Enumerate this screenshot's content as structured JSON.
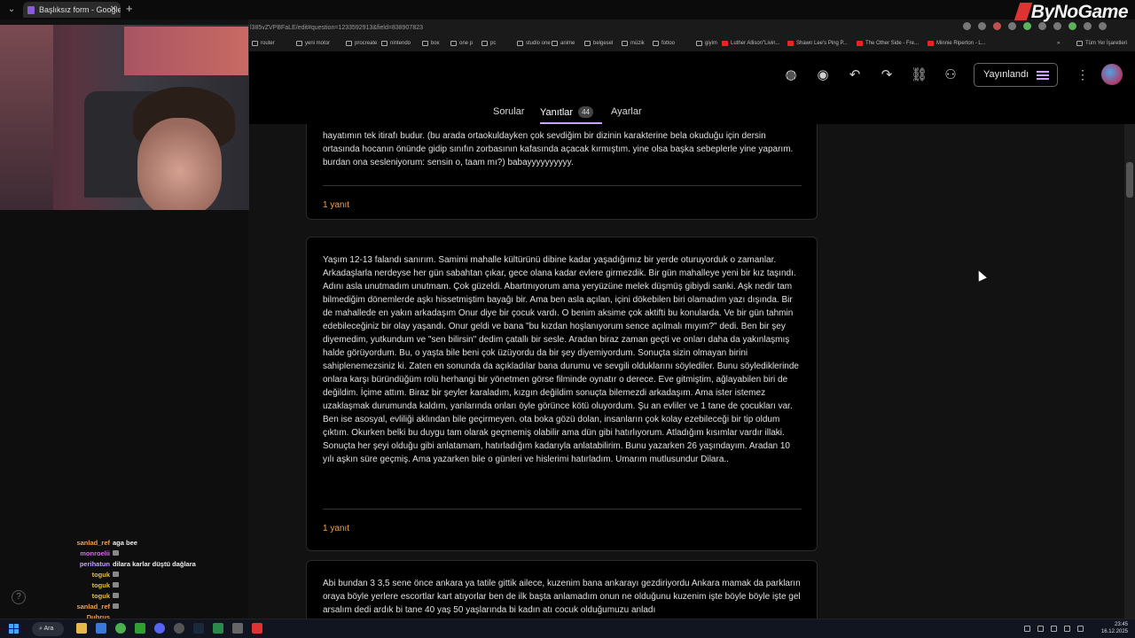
{
  "browser": {
    "tab_title": "Başlıksız form - Google Formlar",
    "tab_close": "✕",
    "new_tab": "+",
    "url": "l385vZVPBFaLE/edit#question=1233592913&field=838907823",
    "bookmarks": [
      {
        "label": "router",
        "kind": "folder"
      },
      {
        "label": "yeni motor",
        "kind": "folder"
      },
      {
        "label": "procreate",
        "kind": "folder"
      },
      {
        "label": "nintendo",
        "kind": "folder"
      },
      {
        "label": "box",
        "kind": "folder"
      },
      {
        "label": "one p",
        "kind": "folder"
      },
      {
        "label": "pc",
        "kind": "folder"
      },
      {
        "label": "studio one",
        "kind": "folder"
      },
      {
        "label": "anime",
        "kind": "folder"
      },
      {
        "label": "belgesel",
        "kind": "folder"
      },
      {
        "label": "müzik",
        "kind": "folder"
      },
      {
        "label": "fottoo",
        "kind": "folder"
      },
      {
        "label": "giyim",
        "kind": "folder"
      },
      {
        "label": "Luther Allison\"Livin...",
        "kind": "youtube"
      },
      {
        "label": "Shawn Lee's Ping P...",
        "kind": "youtube"
      },
      {
        "label": "The Other Side - Fre...",
        "kind": "youtube"
      },
      {
        "label": "Minnie Riperton - L...",
        "kind": "youtube"
      },
      {
        "label": "Tüm Yer İşaretleri",
        "kind": "folder"
      }
    ]
  },
  "logo": "ByNoGame",
  "forms": {
    "publish_label": "Yayınlandı",
    "tabs": {
      "questions": "Sorular",
      "responses": "Yanıtlar",
      "response_count": "44",
      "settings": "Ayarlar"
    }
  },
  "responses": [
    {
      "text": "hayatımın tek itirafı budur. (bu arada ortaokuldayken çok sevdiğim bir dizinin karakterine bela okuduğu için dersin ortasında hocanın önünde gidip sınıfın zorbasının kafasında açacak kırmıştım. yine olsa başka sebeplerle yine yaparım. burdan ona sesleniyorum: sensin o, taam mı?) babayyyyyyyyyy.",
      "reply_label": "1 yanıt"
    },
    {
      "text": "Yaşım 12-13 falandı sanırım. Samimi mahalle kültürünü dibine kadar yaşadığımız bir yerde oturuyorduk o zamanlar. Arkadaşlarla nerdeyse her gün sabahtan çıkar, gece olana kadar evlere girmezdik. Bir gün mahalleye yeni bir kız taşındı. Adını asla unutmadım unutmam. Çok güzeldi. Abartmıyorum ama yeryüzüne melek düşmüş gibiydi sanki. Aşk nedir tam bilmediğim dönemlerde aşkı hissetmiştim bayağı bir. Ama ben asla açılan, içini dökebilen biri olamadım yazı dışında. Bir de mahallede en yakın arkadaşım Onur diye bir çocuk vardı. O benim aksime çok aktifti bu konularda. Ve bir gün tahmin edebileceğiniz bir olay yaşandı. Onur geldi ve bana \"bu kızdan hoşlanıyorum sence açılmalı mıyım?\" dedi. Ben bir şey diyemedim, yutkundum ve \"sen bilirsin\" dedim çatallı bir sesle. Aradan biraz zaman geçti ve onları daha da yakınlaşmış halde görüyordum. Bu, o yaşta bile beni çok üzüyordu da bir şey diyemiyordum. Sonuçta sizin olmayan birini sahiplenemezsiniz ki. Zaten en sonunda da açıkladılar bana durumu ve sevgili olduklarını söylediler. Bunu söylediklerinde onlara karşı büründüğüm rolü herhangi bir yönetmen görse filminde oynatır o derece. Eve gitmiştim, ağlayabilen biri de değildim. İçime attım. Biraz bir şeyler karaladım, kızgın değildim sonuçta bilemezdi arkadaşım. Ama ister istemez uzaklaşmak durumunda kaldım, yanlarında onları öyle görünce kötü oluyordum. Şu an evliler ve 1 tane de çocukları var. Ben ise asosyal, evliliği aklından bile geçirmeyen. ota boka gözü dolan, insanların çok kolay ezebileceği bir tip oldum çıktım. Okurken belki bu duygu tam olarak geçmemiş olabilir ama dün gibi hatırlıyorum. Atladığım kısımlar vardır illaki. Sonuçta her şeyi olduğu gibi anlatamam, hatırladığım kadarıyla anlatabilirim. Bunu yazarken 26 yaşındayım. Aradan 10 yılı aşkın süre geçmiş. Ama yazarken bile o günleri ve hislerimi hatırladım. Umarım mutlusundur Dilara..",
      "reply_label": "1 yanıt"
    },
    {
      "text": "Abi bundan 3 3,5 sene önce ankara ya tatile gittik ailece, kuzenim bana ankarayı gezdiriyordu Ankara mamak da parkların oraya böyle yerlere escortlar kart atıyorlar ben de ilk başta anlamadım onun ne olduğunu kuzenim işte böyle böyle işte gel arsalım dedi ardık bi tane 40 yaş 50 yaşlarında bi kadın atı cocuk olduğumuzu anladı"
    }
  ],
  "chat": [
    {
      "user": "sanlad_ref",
      "color": "#f0a050",
      "message": "aga bee"
    },
    {
      "user": "monroelii",
      "color": "#d070e0",
      "message": "",
      "emote": true
    },
    {
      "user": "perihatun",
      "color": "#c0a0ff",
      "message": "dilara karlar düştü dağlara"
    },
    {
      "user": "toguk",
      "color": "#e0c040",
      "message": "",
      "emote": true
    },
    {
      "user": "toguk",
      "color": "#e0c040",
      "message": "",
      "emote": true
    },
    {
      "user": "toguk",
      "color": "#e0c040",
      "message": "",
      "emote": true
    },
    {
      "user": "sanlad_ref",
      "color": "#f0a050",
      "message": "",
      "emote": true
    },
    {
      "user": "Dubrus",
      "color": "#f0a050",
      "message": ""
    }
  ],
  "taskbar": {
    "search_label": "Ara",
    "time": "23:45",
    "date": "16.12.2025"
  },
  "help_label": "?"
}
